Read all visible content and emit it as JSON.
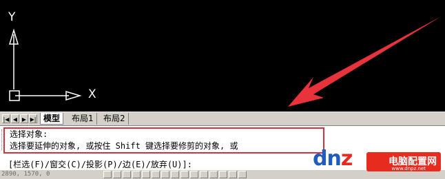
{
  "axes": {
    "y_label": "Y",
    "x_label": "X"
  },
  "tabs": {
    "nav": [
      "|◀",
      "◀",
      "▶",
      "▶|"
    ],
    "items": [
      {
        "label": "模型",
        "active": true
      },
      {
        "label": "布局1",
        "active": false
      },
      {
        "label": "布局2",
        "active": false
      }
    ]
  },
  "command": {
    "line1": "选择对象:",
    "line2": "选择要延伸的对象, 或按住 Shift 键选择要修剪的对象, 或",
    "line3": "[栏选(F)/窗交(C)/投影(P)/边(E)/放弃(U)]:"
  },
  "status": {
    "coords": "2890, 1570, 0"
  },
  "watermark": {
    "logo_a": "dn",
    "logo_z": "z",
    "logo_b": "",
    "cn": "电脑配置网",
    "url": "www.dnpz.net"
  },
  "colors": {
    "arrow": "#e8323c",
    "highlight_box": "#d6303e",
    "watermark_red": "#e72b1f",
    "watermark_blue": "#1e5dbf"
  }
}
